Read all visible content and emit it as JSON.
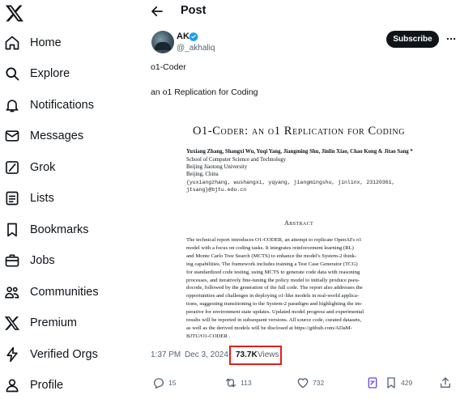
{
  "sidebar": {
    "logo": "x-logo-icon",
    "items": [
      {
        "label": "Home",
        "icon": "home-icon"
      },
      {
        "label": "Explore",
        "icon": "search-icon"
      },
      {
        "label": "Notifications",
        "icon": "bell-icon"
      },
      {
        "label": "Messages",
        "icon": "envelope-icon"
      },
      {
        "label": "Grok",
        "icon": "grok-icon"
      },
      {
        "label": "Lists",
        "icon": "list-icon"
      },
      {
        "label": "Bookmarks",
        "icon": "bookmark-icon"
      },
      {
        "label": "Jobs",
        "icon": "briefcase-icon"
      },
      {
        "label": "Communities",
        "icon": "people-icon"
      },
      {
        "label": "Premium",
        "icon": "x-logo-icon"
      },
      {
        "label": "Verified Orgs",
        "icon": "lightning-icon"
      },
      {
        "label": "Profile",
        "icon": "person-icon"
      }
    ]
  },
  "header": {
    "title": "Post"
  },
  "post": {
    "author_name": "AK",
    "author_handle": "@_akhaliq",
    "subscribe_label": "Subscribe",
    "text_line1": "o1-Coder",
    "text_line2": "an o1 Replication for Coding",
    "time": "1:37 PM",
    "date": "Dec 3, 2024",
    "views_count": "73.7K",
    "views_label": "Views",
    "actions": {
      "replies": "15",
      "reposts": "113",
      "likes": "732",
      "bookmarks": "429"
    }
  },
  "paper": {
    "title": "O1-Coder: an o1 Replication for Coding",
    "authors": "Yuxiang Zhang, Shangxi Wu, Yuqi Yang, Jiangming Shu, Jinlin Xiao, Chao Kong & Jitao Sang *",
    "affiliation": [
      "School of Computer Science and Technology",
      "Beijing Jiaotong University",
      "Beijing, China"
    ],
    "emails": [
      "{yuxiangzhang, wushangxi, yqyang, jiangmingshu, jinlinx, 23120361,",
      "jtsang}@bjtu.edu.cn"
    ],
    "abstract_heading": "Abstract",
    "abstract_lines": [
      "The technical report introduces O1-CODER, an attempt to replicate OpenAI's o1",
      "model with a focus on coding tasks. It integrates reinforcement learning (RL)",
      "and Monte Carlo Tree Search (MCTS) to enhance the model's System-2 think-",
      "ing capabilities. The framework includes training a Test Case Generator (TCG)",
      "for standardized code testing, using MCTS to generate code data with reasoning",
      "processes, and iteratively fine-tuning the policy model to initially produce pseu-",
      "docode, followed by the generation of the full code. The report also addresses the",
      "opportunities and challenges in deploying o1-like models in real-world applica-",
      "tions, suggesting transitioning to the System-2 paradigm and highlighting the im-",
      "perative for environment state updates. Updated model progress and experimental",
      "results will be reported in subsequent versions. All source code, curated datasets,",
      "as well as the derived models will be disclosed at https://github.com/ADaM-",
      "BJTU/O1-CODER ."
    ]
  },
  "colors": {
    "text": "#0f1419",
    "muted": "#536471",
    "verified": "#1d9bf0",
    "highlight": "#e0201a"
  }
}
